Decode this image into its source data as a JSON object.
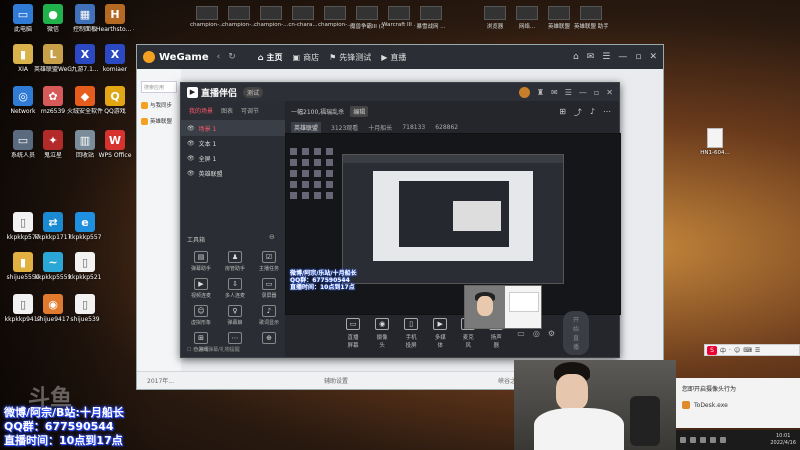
{
  "desktop": {
    "top_apps": [
      "champion-...",
      "champion-...",
      "champion-...",
      "cn-chara...",
      "champion-...",
      "魔兽争霸III\n(冰封王座)",
      "Warcraft III\n...",
      "暴雪战网\n...",
      "浏览器",
      "网络...",
      "英雄联盟",
      "英雄联盟\n助手"
    ],
    "icons_left": [
      {
        "label": "此电脑",
        "glyph": "▭",
        "color": "#2f7bd6"
      },
      {
        "label": "微信",
        "glyph": "●",
        "color": "#21b34b"
      },
      {
        "label": "控制面板",
        "glyph": "▦",
        "color": "#3f70b8"
      },
      {
        "label": "Hearthsto... - 快捷方式",
        "glyph": "H",
        "color": "#b56a24"
      },
      {
        "label": "XIA",
        "glyph": "▮",
        "color": "#d9b24c"
      },
      {
        "label": "英雄联盟WeGame版",
        "glyph": "L",
        "color": "#c8a04a"
      },
      {
        "label": "九游7.1...",
        "glyph": "X",
        "color": "#2b49c2"
      },
      {
        "label": "komiaer",
        "glyph": "X",
        "color": "#2b49c2"
      },
      {
        "label": "Network",
        "glyph": "◎",
        "color": "#2f7bd6"
      },
      {
        "label": "mz6539",
        "glyph": "✿",
        "color": "#d65a5a"
      },
      {
        "label": "火绒安全软件",
        "glyph": "◆",
        "color": "#e55c1c"
      },
      {
        "label": "QQ游戏",
        "glyph": "Q",
        "color": "#e2a614"
      },
      {
        "label": "系统人员",
        "glyph": "▭",
        "color": "#5a6b80"
      },
      {
        "label": "鬼泣星",
        "glyph": "✦",
        "color": "#b22a2a"
      },
      {
        "label": "回收站",
        "glyph": "▥",
        "color": "#7a8c99"
      },
      {
        "label": "WPS Office",
        "glyph": "W",
        "color": "#d8322e"
      },
      {
        "label": "kkpkkp577",
        "glyph": "▯",
        "color": "#f2f2f2"
      },
      {
        "label": "kkpkkp1717",
        "glyph": "⇄",
        "color": "#1a8ad3"
      },
      {
        "label": "kkpkkp557",
        "glyph": "e",
        "color": "#1f8fdf"
      },
      {
        "label": "shijue5559",
        "glyph": "▮",
        "color": "#e0b040"
      },
      {
        "label": "kkpkkp5559",
        "glyph": "~",
        "color": "#2aa7d6"
      },
      {
        "label": "kkpkkp521",
        "glyph": "▯",
        "color": "#f2f2f2"
      },
      {
        "label": "kkpkkp9417",
        "glyph": "▯",
        "color": "#f2f2f2"
      },
      {
        "label": "shijue9417",
        "glyph": "◉",
        "color": "#e07a2e"
      },
      {
        "label": "shijue539",
        "glyph": "▯",
        "color": "#f2f2f2"
      }
    ],
    "file_right": "HN1-604..."
  },
  "wegame": {
    "logo": "WeGame",
    "nav": [
      {
        "label": "主页",
        "icon": "home-icon",
        "glyph": "⌂"
      },
      {
        "label": "商店",
        "icon": "store-icon",
        "glyph": "▣"
      },
      {
        "label": "先锋测试",
        "icon": "flag-icon",
        "glyph": "⚑"
      },
      {
        "label": "直播",
        "icon": "live-icon",
        "glyph": "▶"
      }
    ],
    "search_placeholder": "搜索应用",
    "side_items": [
      "与我同步",
      "英雄联盟"
    ],
    "footer_left": "2017年...",
    "footer_mid": "辅助设置",
    "footer_right": "峡谷之巅"
  },
  "live": {
    "title": "直播伴侣",
    "version": "测试",
    "tabs": [
      "我的场景",
      "图表",
      "可调节"
    ],
    "scenes": [
      {
        "label": "场景 1",
        "active": true
      },
      {
        "label": "文本 1",
        "active": false
      },
      {
        "label": "全屏 1",
        "active": false
      },
      {
        "label": "英雄联盟",
        "active": false
      }
    ],
    "tools_title": "工具箱",
    "tools": [
      {
        "label": "弹幕助手",
        "glyph": "▤"
      },
      {
        "label": "房管助手",
        "glyph": "♟"
      },
      {
        "label": "主播任务",
        "glyph": "☑"
      },
      {
        "label": "视频连麦",
        "glyph": "▶"
      },
      {
        "label": "多人连麦",
        "glyph": "⇩"
      },
      {
        "label": "录屏器",
        "glyph": "▭"
      },
      {
        "label": "虚拟形象",
        "glyph": "☺"
      },
      {
        "label": "弹幕娘",
        "glyph": "♀"
      },
      {
        "label": "歌词显示",
        "glyph": "♪"
      },
      {
        "label": "小游戏",
        "glyph": "⊞"
      },
      {
        "label": "",
        "glyph": "⋯"
      },
      {
        "label": "",
        "glyph": "⊕"
      }
    ],
    "left_footer": "☐ 已关闭弹幕/礼物提醒",
    "info_title": "一幅2100,福瑞乱杀",
    "info_tag": "编辑",
    "stats": [
      "英雄联盟",
      "3123观看",
      "十月船长",
      "718133",
      "628862"
    ],
    "overlay_lines": [
      "微博/阿宗/乐站/十月船长",
      "QQ群：677590544",
      "直播时间：10点到17点"
    ],
    "controls": [
      {
        "label": "直播屏幕",
        "glyph": "▭"
      },
      {
        "label": "摄像头",
        "glyph": "◉"
      },
      {
        "label": "手机投屏",
        "glyph": "▯"
      },
      {
        "label": "多媒体",
        "glyph": "▶"
      },
      {
        "label": "麦克风",
        "glyph": "♫"
      },
      {
        "label": "扬声器",
        "glyph": "◁"
      }
    ],
    "start_button": "开始直播"
  },
  "ime": {
    "label": "中",
    "items": [
      "·",
      "☺",
      "⌨",
      "☰"
    ]
  },
  "notification": {
    "title": "您即开启摄像头行为",
    "app": "ToDesk.exe"
  },
  "tray": {
    "time": "10:01",
    "date": "2022/4/16"
  },
  "overlay": {
    "lines": [
      "微博/阿宗/B站:十月船长",
      "QQ群：677590544",
      "直播时间：10点到17点"
    ],
    "watermark": "斗鱼"
  }
}
